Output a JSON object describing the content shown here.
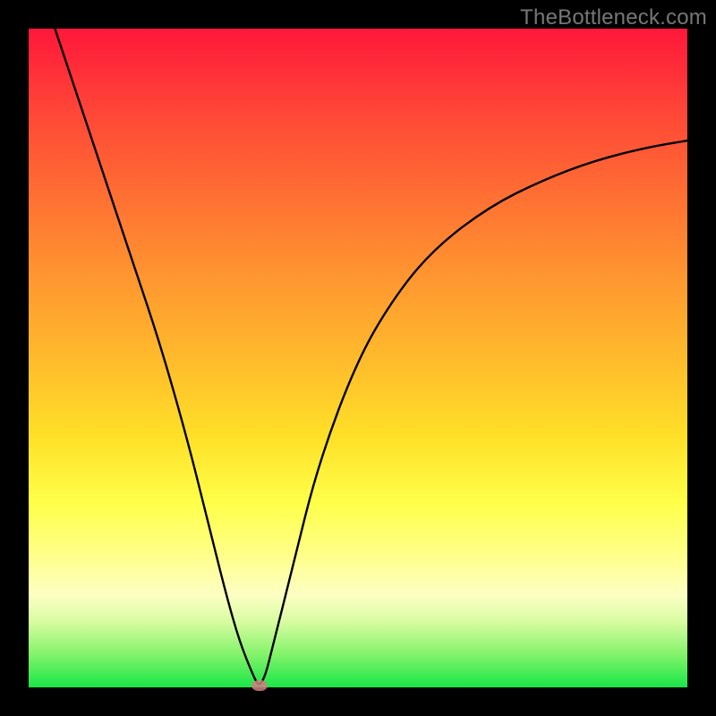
{
  "watermark": "TheBottleneck.com",
  "colors": {
    "frame": "#000000",
    "curve": "#000000",
    "dot": "#d08080"
  },
  "chart_data": {
    "type": "line",
    "title": "",
    "xlabel": "",
    "ylabel": "",
    "xlim": [
      0,
      100
    ],
    "ylim": [
      0,
      100
    ],
    "grid": false,
    "legend": false,
    "series": [
      {
        "name": "bottleneck-curve",
        "x": [
          4,
          8,
          12,
          16,
          20,
          24,
          27,
          30,
          32,
          34,
          35,
          36,
          37,
          40,
          44,
          50,
          56,
          62,
          70,
          78,
          86,
          94,
          100
        ],
        "y": [
          100,
          88,
          76,
          64,
          52,
          38,
          26,
          14,
          7,
          2,
          0,
          2,
          6,
          18,
          34,
          50,
          60,
          67,
          73,
          77,
          80,
          82,
          83
        ]
      }
    ],
    "marker": {
      "name": "sweet-spot-dot",
      "x": 35,
      "y": 0
    },
    "background": {
      "type": "vertical-gradient",
      "stops": [
        {
          "pos": 0,
          "color": "#ff173a"
        },
        {
          "pos": 25,
          "color": "#ff6e33"
        },
        {
          "pos": 50,
          "color": "#ffba2c"
        },
        {
          "pos": 72,
          "color": "#ffff4a"
        },
        {
          "pos": 90,
          "color": "#d8fca2"
        },
        {
          "pos": 100,
          "color": "#18e648"
        }
      ]
    }
  }
}
